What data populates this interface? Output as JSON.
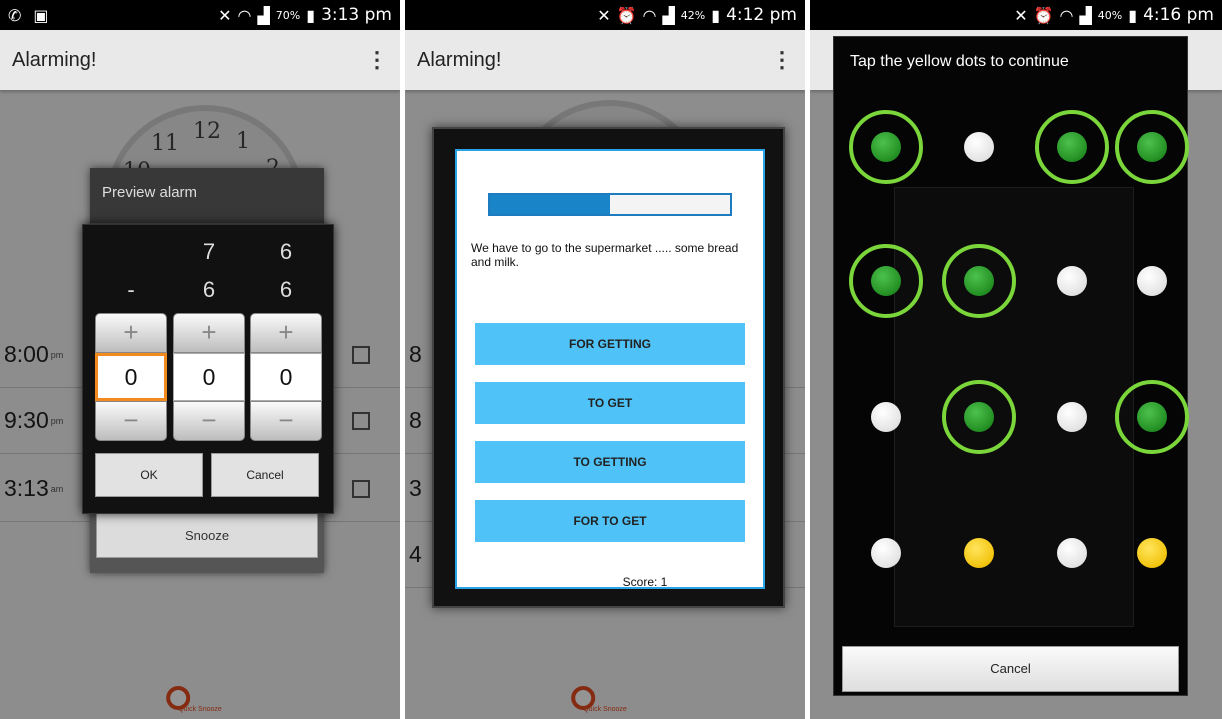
{
  "screen1": {
    "status": {
      "left_icons": [
        "whatsapp-icon",
        "gallery-icon"
      ],
      "battery": "70%",
      "time": "3:13 pm"
    },
    "app_title": "Alarming!",
    "alarms": [
      {
        "time": "8:00",
        "ampm": "pm"
      },
      {
        "time": "9:30",
        "ampm": "pm"
      },
      {
        "time": "3:13",
        "ampm": "am"
      }
    ],
    "preview_dialog": {
      "title": "Preview alarm",
      "snooze_label": "Snooze"
    },
    "picker": {
      "columns": [
        {
          "above1": "",
          "above2": "-",
          "value": "0"
        },
        {
          "above1": "7",
          "above2": "6",
          "value": "0"
        },
        {
          "above1": "6",
          "above2": "6",
          "value": "0"
        }
      ],
      "ok_label": "OK",
      "cancel_label": "Cancel"
    },
    "quick_snooze": "Quick Snooze"
  },
  "screen2": {
    "status": {
      "battery": "42%",
      "time": "4:12 pm"
    },
    "app_title": "Alarming!",
    "quiz": {
      "progress": 0.5,
      "question": "We have to go to the supermarket ..... some bread and milk.",
      "answers": [
        "FOR GETTING",
        "TO GET",
        "TO GETTING",
        "FOR TO GET"
      ],
      "score": "Score: 1"
    },
    "quick_snooze": "Quick Snooze"
  },
  "screen3": {
    "status": {
      "battery": "40%",
      "time": "4:16 pm"
    },
    "instruction": "Tap the yellow dots to continue",
    "cancel_label": "Cancel",
    "dot_grid": [
      [
        "green",
        "white",
        "green",
        "green"
      ],
      [
        "green",
        "green",
        "white",
        "white"
      ],
      [
        "white",
        "green",
        "white",
        "green"
      ],
      [
        "white",
        "yellow",
        "white",
        "yellow"
      ]
    ]
  },
  "colors": {
    "accent_blue": "#4fc3f7",
    "progress_blue": "#1a84c9",
    "focus_orange": "#f28a1d",
    "ring_green": "#7ad63a",
    "dot_yellow": "#f2c40e"
  }
}
